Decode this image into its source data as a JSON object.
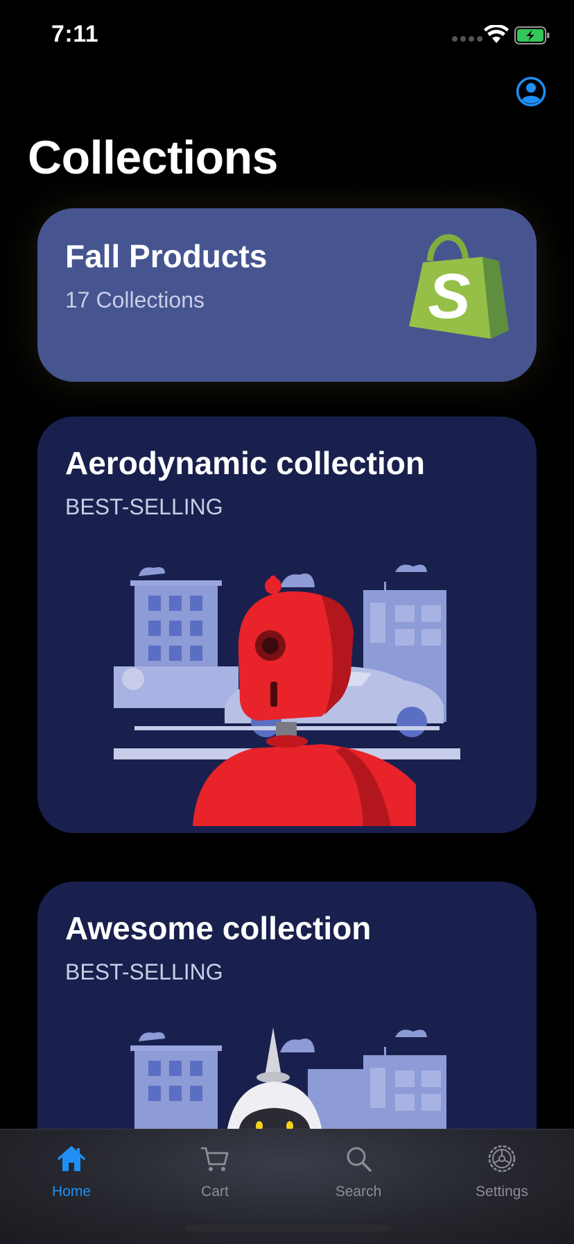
{
  "status_bar": {
    "time": "7:11"
  },
  "header": {
    "title": "Collections",
    "profile_icon": "person-circle-icon"
  },
  "colors": {
    "accent": "#1f8ff5",
    "card_featured": "#465590",
    "card": "#19204d",
    "robot_red": "#e8232a"
  },
  "featured_card": {
    "title": "Fall Products",
    "subtitle": "17 Collections",
    "logo_letter": "S"
  },
  "collections": [
    {
      "title": "Aerodynamic collection",
      "subtitle": "BEST-SELLING",
      "image": "red-robot-city-illustration"
    },
    {
      "title": "Awesome collection",
      "subtitle": "BEST-SELLING",
      "image": "white-robot-city-illustration"
    }
  ],
  "tab_bar": {
    "tabs": [
      {
        "label": "Home",
        "icon": "house-icon",
        "active": true
      },
      {
        "label": "Cart",
        "icon": "cart-icon",
        "active": false
      },
      {
        "label": "Search",
        "icon": "magnifying-glass-icon",
        "active": false
      },
      {
        "label": "Settings",
        "icon": "gear-icon",
        "active": false
      }
    ]
  }
}
